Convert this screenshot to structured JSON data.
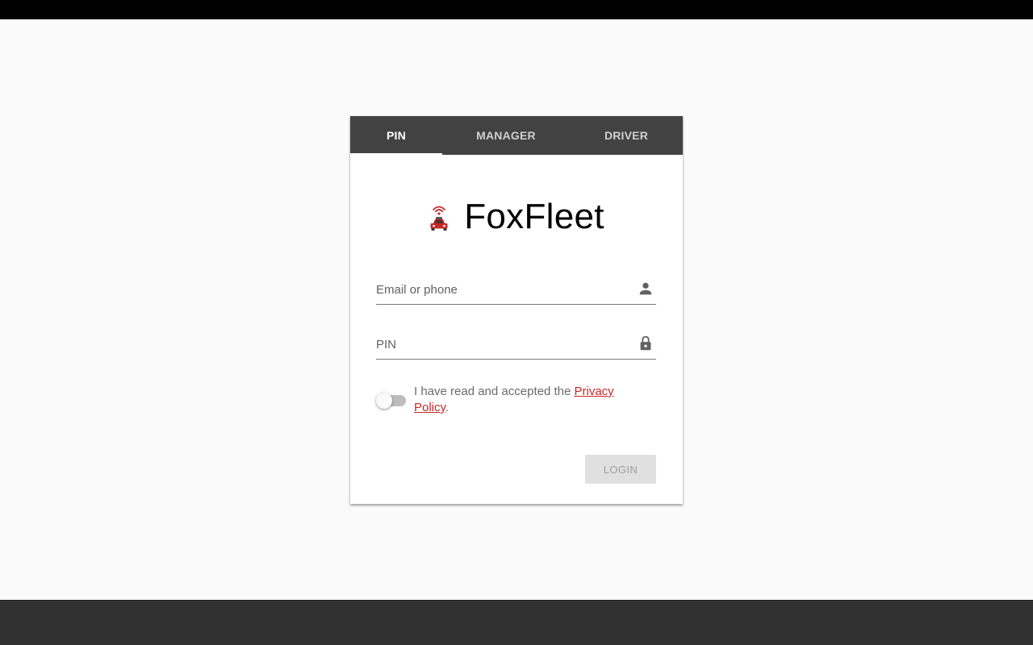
{
  "tabs": {
    "pin": "PIN",
    "manager": "MANAGER",
    "driver": "DRIVER",
    "active": "PIN"
  },
  "brand": {
    "title": "FoxFleet",
    "logo_icon": "car-wifi-icon",
    "accent_color": "#c62828"
  },
  "form": {
    "email_placeholder": "Email or phone",
    "email_icon": "person-icon",
    "pin_placeholder": "PIN",
    "pin_icon": "lock-icon",
    "privacy_toggle_on": false,
    "consent_prefix": "I have read and accepted the ",
    "privacy_link": "Privacy Policy",
    "consent_suffix": ".",
    "login_label": "LOGIN",
    "login_enabled": false
  },
  "colors": {
    "tab_bar": "#424242",
    "page_background": "#fafafa",
    "bottom_bar": "#303030"
  }
}
